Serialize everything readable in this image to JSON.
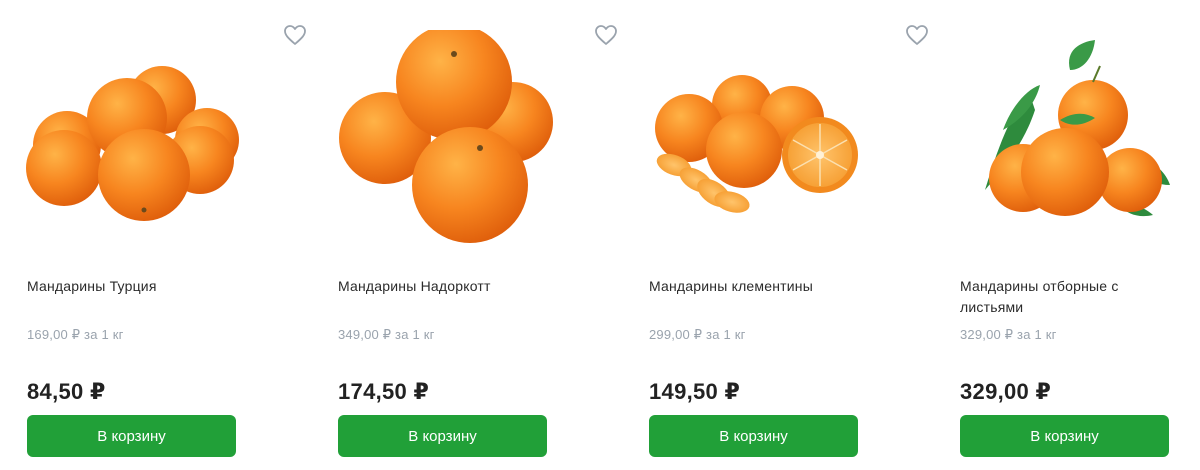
{
  "theme": {
    "accent_green": "#21a038",
    "heart_outline": "#9aa3ad"
  },
  "products": [
    {
      "name": "Мандарины Турция",
      "unit_price": "169,00 ₽ за 1 кг",
      "price": "84,50 ₽",
      "cart_label": "В корзину",
      "icon": "heart-outline-icon"
    },
    {
      "name": "Мандарины Надоркотт",
      "unit_price": "349,00 ₽ за 1 кг",
      "price": "174,50 ₽",
      "cart_label": "В корзину",
      "icon": "heart-outline-icon"
    },
    {
      "name": "Мандарины клементины",
      "unit_price": "299,00 ₽ за 1 кг",
      "price": "149,50 ₽",
      "cart_label": "В корзину",
      "icon": "heart-outline-icon"
    },
    {
      "name": "Мандарины отборные с листьями",
      "unit_price": "329,00 ₽ за 1 кг",
      "price": "329,00 ₽",
      "cart_label": "В корзину",
      "icon": "heart-outline-icon"
    }
  ]
}
